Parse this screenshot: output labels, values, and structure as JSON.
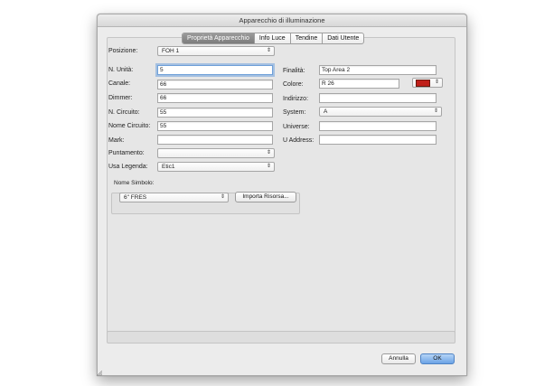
{
  "window": {
    "title": "Apparecchio di illuminazione"
  },
  "tabs": [
    {
      "label": "Proprietà Apparecchio",
      "active": true
    },
    {
      "label": "Info Luce",
      "active": false
    },
    {
      "label": "Tendine",
      "active": false
    },
    {
      "label": "Dati Utente",
      "active": false
    }
  ],
  "position": {
    "label": "Posizione:",
    "value": "FOH 1"
  },
  "left_fields": {
    "unit_number": {
      "label": "N. Unità:",
      "value": "5"
    },
    "channel": {
      "label": "Canale:",
      "value": "66"
    },
    "dimmer": {
      "label": "Dimmer:",
      "value": "66"
    },
    "circuit_number": {
      "label": "N. Circuito:",
      "value": "55"
    },
    "circuit_name": {
      "label": "Nome Circuito:",
      "value": "55"
    },
    "mark": {
      "label": "Mark:",
      "value": ""
    },
    "focus": {
      "label": "Puntamento:",
      "value": ""
    },
    "legend": {
      "label": "Usa Legenda:",
      "value": "Etic1"
    }
  },
  "right_fields": {
    "purpose": {
      "label": "Finalità:",
      "value": "Top Area 2"
    },
    "color": {
      "label": "Colore:",
      "value": "R 26",
      "swatch_color": "#c0201a"
    },
    "address": {
      "label": "Indirizzo:",
      "value": ""
    },
    "system": {
      "label": "System:",
      "value": "A"
    },
    "universe": {
      "label": "Universe:",
      "value": ""
    },
    "u_address": {
      "label": "U Address:",
      "value": ""
    }
  },
  "symbol": {
    "label": "Nome Simbolo:",
    "value": "6\" FRES",
    "import_button": "Importa Risorsa..."
  },
  "footer": {
    "cancel_label": "Annulla",
    "ok_label": "OK"
  },
  "icons": {
    "select_arrows": "⇕"
  }
}
